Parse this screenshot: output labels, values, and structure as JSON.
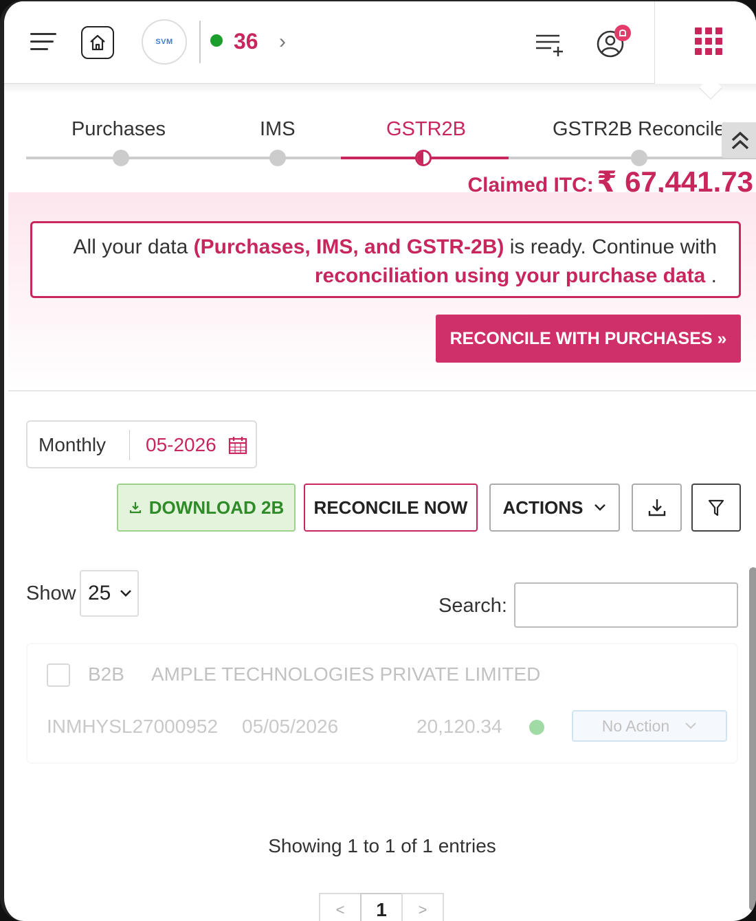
{
  "topbar": {
    "logo_text": "SVM",
    "count": "36",
    "icons": [
      "menu-icon",
      "home-icon",
      "chevron-right-icon",
      "list-add-icon",
      "user-notification-icon",
      "apps-grid-icon"
    ],
    "accent_color": "#c8275c",
    "status_color": "#1b9e2b"
  },
  "steps": [
    {
      "label": "Purchases",
      "active": false
    },
    {
      "label": "IMS",
      "active": false
    },
    {
      "label": "GSTR2B",
      "active": true
    },
    {
      "label": "GSTR2B Reconcile",
      "active": false
    }
  ],
  "claimed": {
    "label": "Claimed ITC:",
    "value": "₹ 67,441.73"
  },
  "notice": {
    "part1": "All your data ",
    "highlight1": "(Purchases, IMS, and GSTR-2B)",
    "part2": " is ready. Continue with",
    "highlight2": "reconciliation using your purchase data",
    "part3": " ."
  },
  "reconcile_purchases_button": "RECONCILE WITH PURCHASES »",
  "period": {
    "mode": "Monthly",
    "date": "05-2026"
  },
  "toolbar": {
    "download_2b": "DOWNLOAD 2B",
    "reconcile_now": "RECONCILE NOW",
    "actions": "ACTIONS"
  },
  "table_controls": {
    "show_label": "Show",
    "page_size": "25",
    "search_label": "Search:",
    "search_value": ""
  },
  "rows": [
    {
      "type": "B2B",
      "vendor": "AMPLE TECHNOLOGIES PRIVATE LIMITED",
      "invoice": "INMHYSL27000952",
      "date": "05/05/2026",
      "amount": "20,120.34",
      "action": "No Action"
    }
  ],
  "footer": {
    "entries": "Showing 1 to 1 of 1 entries",
    "prev": "<",
    "page": "1",
    "next": ">"
  }
}
